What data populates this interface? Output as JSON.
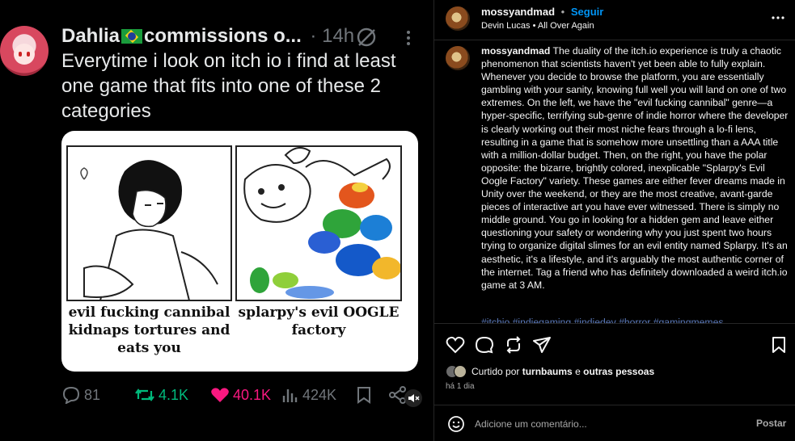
{
  "tweet": {
    "author_name": "Dahlia",
    "author_suffix": "commissions o...",
    "time": "14h",
    "separator": "·",
    "text": "Everytime i look on itch io i find at least one game that fits into one of these 2 categories",
    "image": {
      "caption_left": "evil fucking cannibal kidnaps tortures and eats you",
      "caption_right": "splarpy's evil OOGLE factory"
    },
    "stats": {
      "replies": "81",
      "reposts": "4.1K",
      "likes": "40.1K",
      "views": "424K"
    },
    "colors": {
      "repost": "#00ba7c",
      "like": "#f91880",
      "muted": "#71767b"
    }
  },
  "instagram": {
    "username": "mossyandmad",
    "dot": "•",
    "follow_label": "Seguir",
    "audio": "Devin Lucas • All Over Again",
    "caption_user": "mossyandmad",
    "caption": "The duality of the itch.io experience is truly a chaotic phenomenon that scientists haven't yet been able to fully explain. Whenever you decide to browse the platform, you are essentially gambling with your sanity, knowing full well you will land on one of two extremes. On the left, we have the \"evil fucking cannibal\" genre—a hyper-specific, terrifying sub-genre of indie horror where the developer is clearly working out their most niche fears through a lo-fi lens, resulting in a game that is somehow more unsettling than a AAA title with a million-dollar budget. Then, on the right, you have the polar opposite: the bizarre, brightly colored, inexplicable \"Splarpy's Evil Oogle Factory\" variety. These games are either fever dreams made in Unity over the weekend, or they are the most creative, avant-garde pieces of interactive art you have ever witnessed. There is simply no middle ground. You go in looking for a hidden gem and leave either questioning your safety or wondering why you just spent two hours trying to organize digital slimes for an evil entity named Splarpy. It's an aesthetic, it's a lifestyle, and it's arguably the most authentic corner of the internet. Tag a friend who has definitely downloaded a weird itch.io game at 3 AM.",
    "hashtags": "#itchio #indiegaming #indiedev #horror #gamingmemes",
    "liked_prefix": "Curtido por",
    "liked_user": "turnbaums",
    "liked_connector": "e",
    "liked_others": "outras pessoas",
    "date": "há 1 dia",
    "comment_placeholder": "Adicione um comentário...",
    "post_label": "Postar",
    "colors": {
      "accent": "#0095f6",
      "hashtag": "#5a78b8",
      "border": "#262626"
    }
  }
}
